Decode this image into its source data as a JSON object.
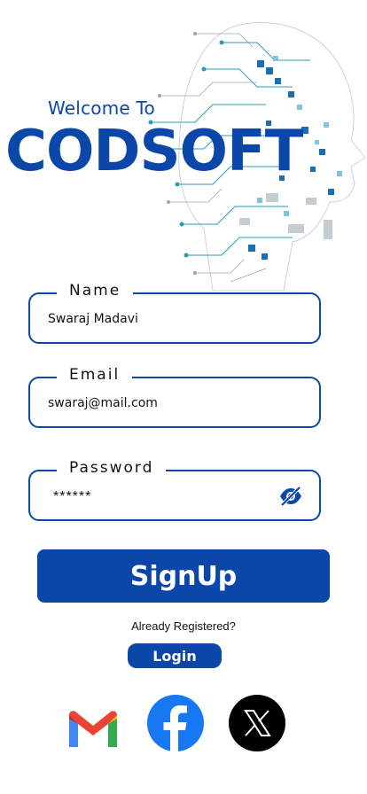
{
  "hero": {
    "welcome": "Welcome To",
    "brand": "CODSOFT"
  },
  "form": {
    "name": {
      "label": "Name",
      "value": "Swaraj Madavi"
    },
    "email": {
      "label": "Email",
      "value": "swaraj@mail.com"
    },
    "password": {
      "label": "Password",
      "value": "******",
      "toggle_icon": "eye-slash-icon"
    }
  },
  "actions": {
    "signup_label": "SignUp",
    "already_registered": "Already Registered?",
    "login_label": "Login"
  },
  "social": [
    {
      "name": "Gmail",
      "icon": "gmail-icon"
    },
    {
      "name": "Facebook",
      "icon": "facebook-icon"
    },
    {
      "name": "X",
      "icon": "x-icon"
    }
  ],
  "colors": {
    "primary": "#0b47a8",
    "facebook": "#1877f2",
    "x": "#000000"
  }
}
